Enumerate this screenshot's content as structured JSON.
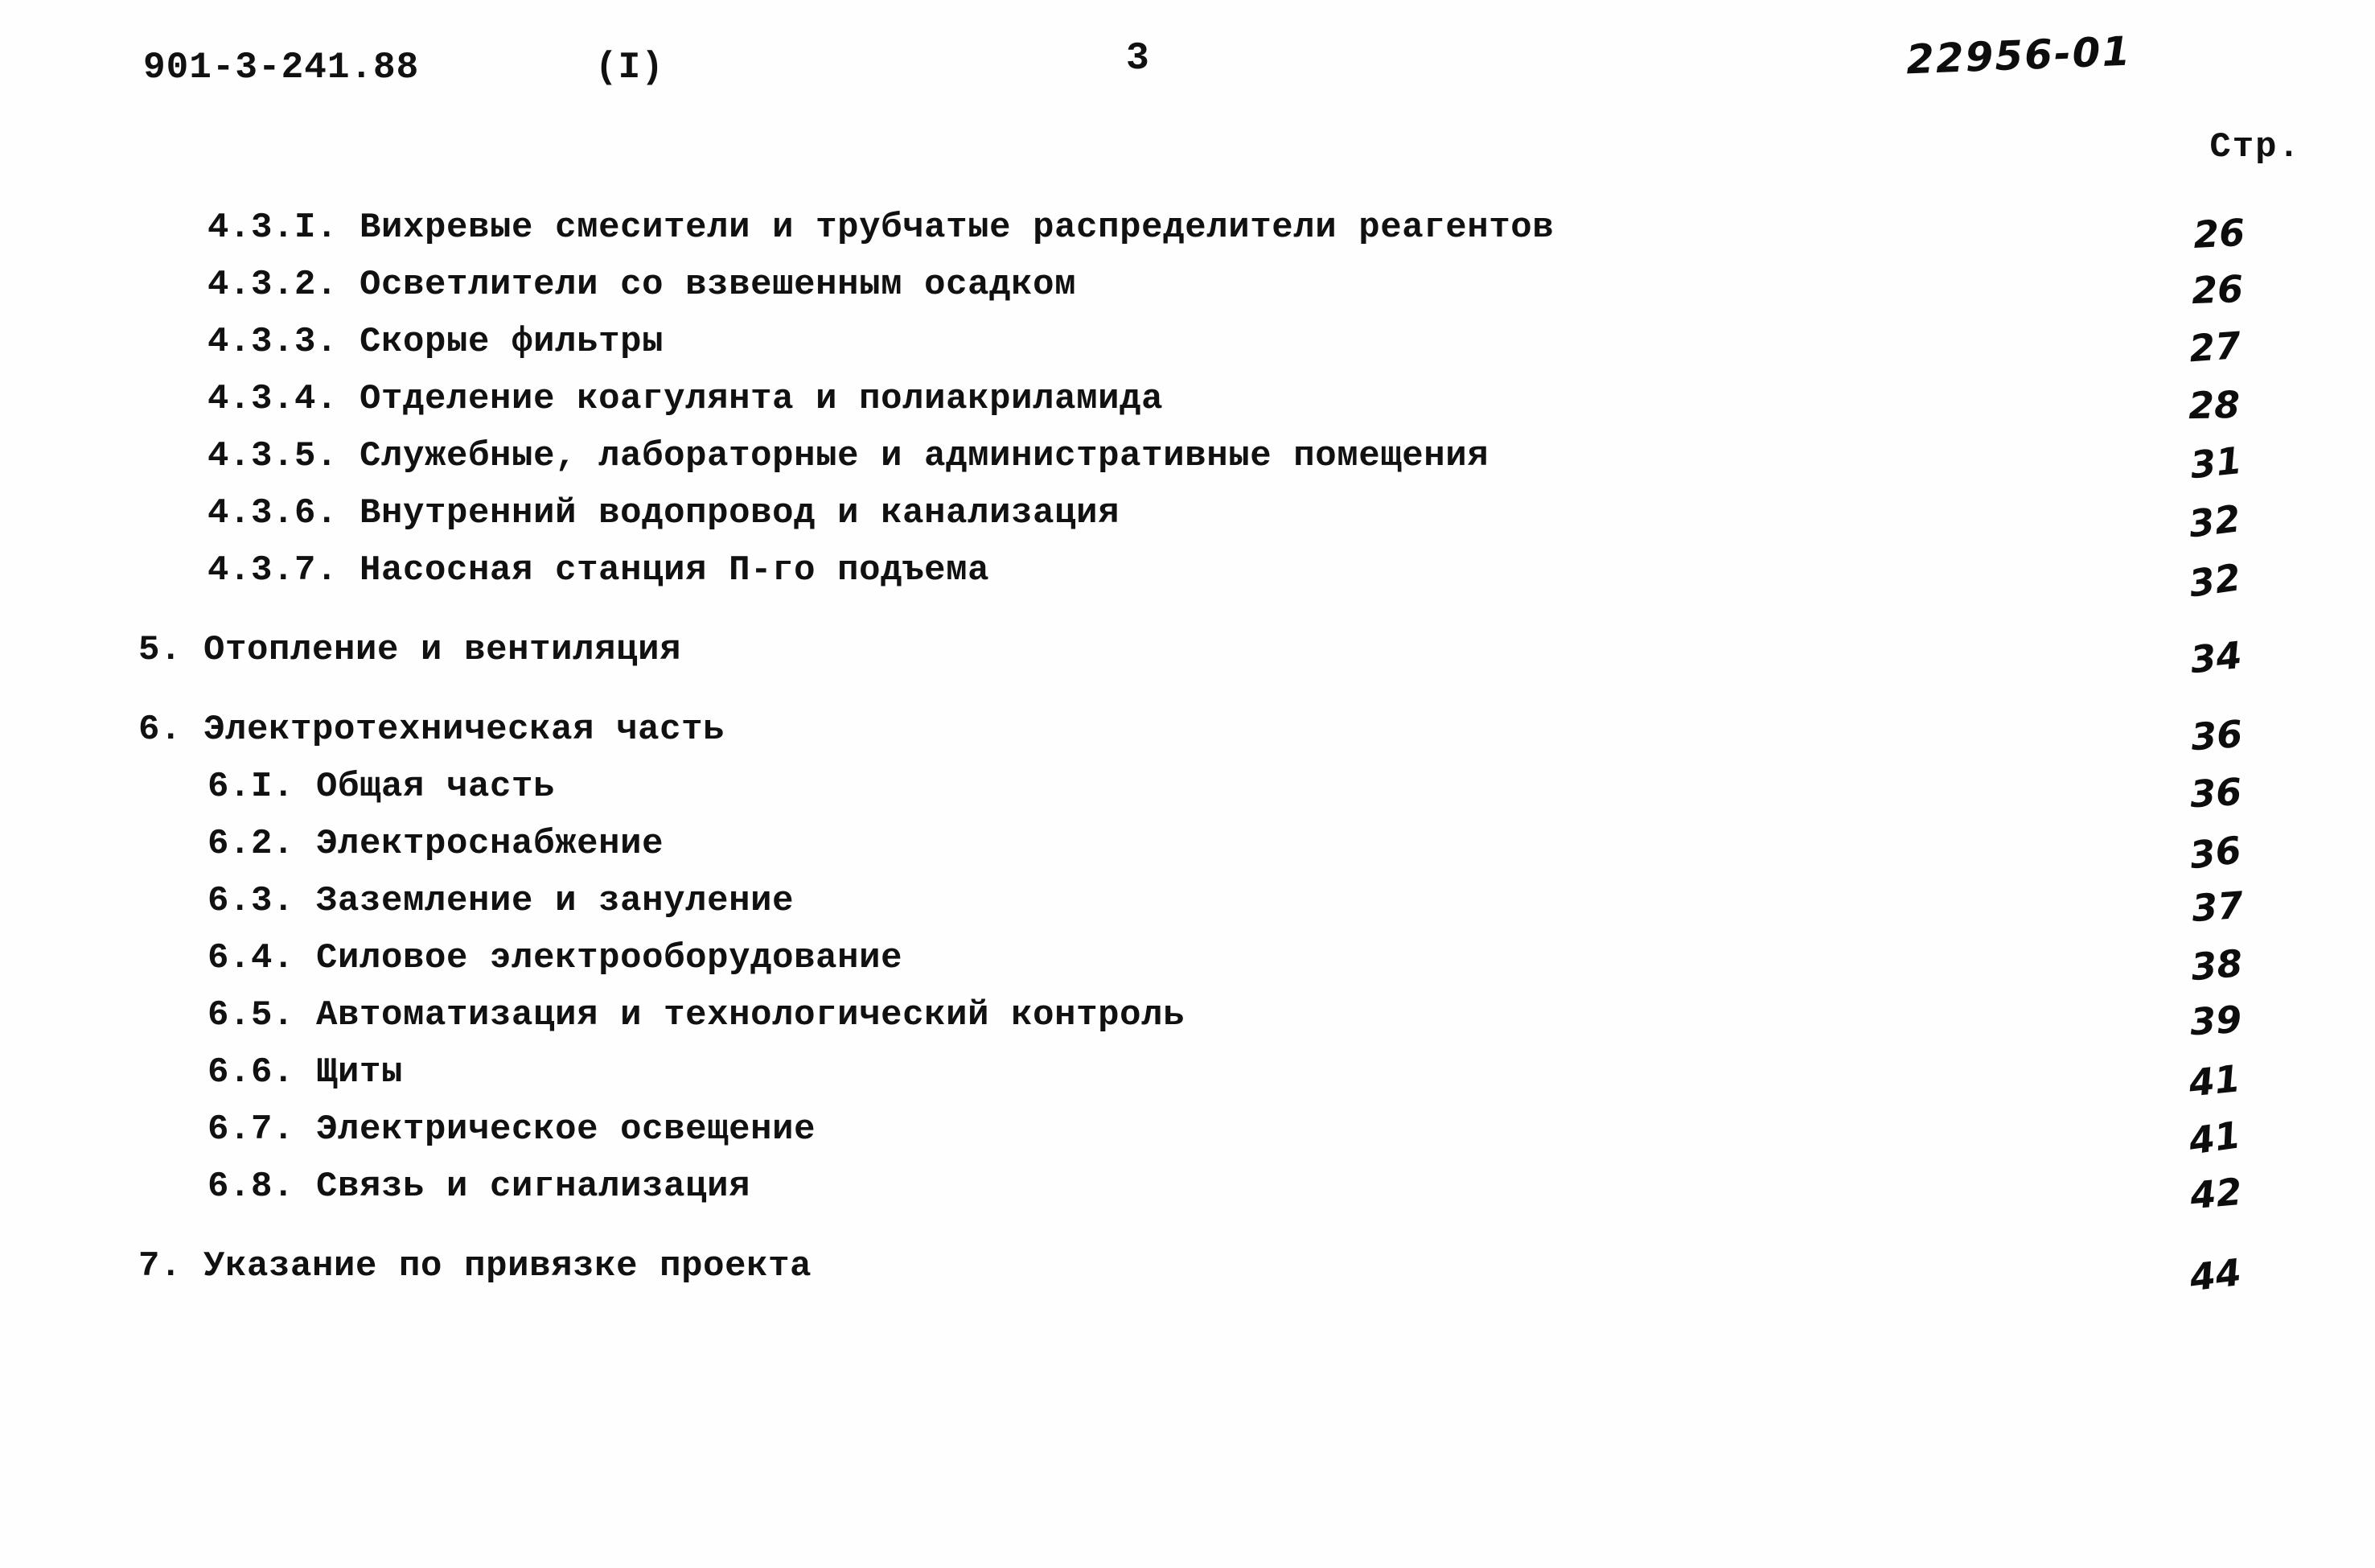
{
  "page": {
    "background_color": "#fefefe",
    "text_color": "#111111"
  },
  "header": {
    "document_code": "901-3-241.88",
    "part_mark": "(I)",
    "folio_number": "3",
    "archive_stamp": "22956-01"
  },
  "contents": {
    "page_column_caption": "Стр.",
    "rows": [
      {
        "number": "4.3.I.",
        "title": "Вихревые смесители и трубчатые распределители реагентов",
        "label": "4.3.I. Вихревые смесители и трубчатые распределители реагентов",
        "page": "26",
        "level": 3,
        "gap_before": false
      },
      {
        "number": "4.3.2.",
        "title": "Осветлители со взвешенным осадком",
        "label": "4.3.2. Осветлители со взвешенным осадком",
        "page": "26",
        "level": 3,
        "gap_before": false
      },
      {
        "number": "4.3.3.",
        "title": "Скорые фильтры",
        "label": "4.3.3. Скорые фильтры",
        "page": "27",
        "level": 3,
        "gap_before": false
      },
      {
        "number": "4.3.4.",
        "title": "Отделение коагулянта и полиакриламида",
        "label": "4.3.4. Отделение коагулянта и полиакриламида",
        "page": "28",
        "level": 3,
        "gap_before": false
      },
      {
        "number": "4.3.5.",
        "title": "Служебные, лабораторные и административные помещения",
        "label": "4.3.5. Служебные, лабораторные и административные помещения",
        "page": "31",
        "level": 3,
        "gap_before": false
      },
      {
        "number": "4.3.6.",
        "title": "Внутренний водопровод и канализация",
        "label": "4.3.6. Внутренний водопровод и канализация",
        "page": "32",
        "level": 3,
        "gap_before": false
      },
      {
        "number": "4.3.7.",
        "title": "Насосная станция П-го подъема",
        "label": "4.3.7. Насосная станция П-го подъема",
        "page": "32",
        "level": 3,
        "gap_before": false
      },
      {
        "number": "5.",
        "title": "Отопление и вентиляция",
        "label": "5. Отопление и вентиляция",
        "page": "34",
        "level": 1,
        "gap_before": true
      },
      {
        "number": "6.",
        "title": "Электротехническая часть",
        "label": "6. Электротехническая часть",
        "page": "36",
        "level": 1,
        "gap_before": true
      },
      {
        "number": "6.I.",
        "title": "Общая часть",
        "label": "6.I. Общая часть",
        "page": "36",
        "level": 2,
        "gap_before": false
      },
      {
        "number": "6.2.",
        "title": "Электроснабжение",
        "label": "6.2. Электроснабжение",
        "page": "36",
        "level": 2,
        "gap_before": false
      },
      {
        "number": "6.3.",
        "title": "Заземление и зануление",
        "label": "6.3. Заземление и зануление",
        "page": "37",
        "level": 2,
        "gap_before": false
      },
      {
        "number": "6.4.",
        "title": "Силовое электрооборудование",
        "label": "6.4. Силовое электрооборудование",
        "page": "38",
        "level": 2,
        "gap_before": false
      },
      {
        "number": "6.5.",
        "title": "Автоматизация и технологический контроль",
        "label": "6.5. Автоматизация и технологический контроль",
        "page": "39",
        "level": 2,
        "gap_before": false
      },
      {
        "number": "6.6.",
        "title": "Щиты",
        "label": "6.6. Щиты",
        "page": "41",
        "level": 2,
        "gap_before": false
      },
      {
        "number": "6.7.",
        "title": "Электрическое освещение",
        "label": "6.7. Электрическое освещение",
        "page": "41",
        "level": 2,
        "gap_before": false
      },
      {
        "number": "6.8.",
        "title": "Связь и сигнализация",
        "label": "6.8. Связь и сигнализация",
        "page": "42",
        "level": 2,
        "gap_before": false
      },
      {
        "number": "7.",
        "title": "Указание по привязке проекта",
        "label": "7. Указание по привязке проекта",
        "page": "44",
        "level": 1,
        "gap_before": true
      }
    ]
  }
}
